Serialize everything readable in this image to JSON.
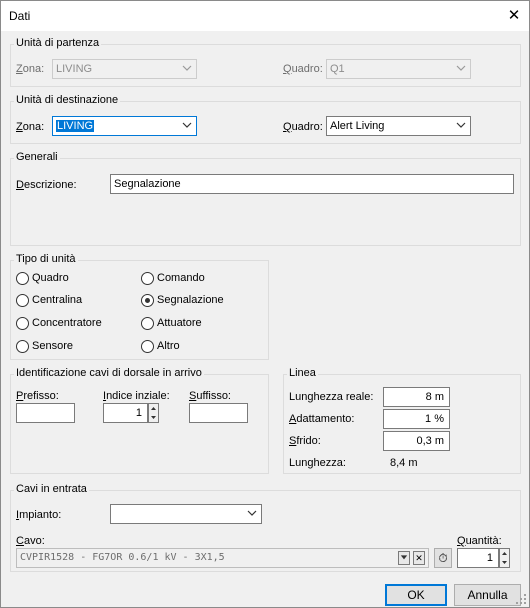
{
  "window": {
    "title": "Dati",
    "close_glyph": "✕"
  },
  "partenza": {
    "group_label": "Unità di partenza",
    "zona_label": "Zona:",
    "zona_value": "LIVING",
    "quadro_label": "Quadro:",
    "quadro_value": "Q1"
  },
  "destinazione": {
    "group_label": "Unità di destinazione",
    "zona_label": "Zona:",
    "zona_value": "LIVING",
    "quadro_label": "Quadro:",
    "quadro_value": "Alert Living"
  },
  "generali": {
    "group_label": "Generali",
    "descrizione_label": "Descrizione:",
    "descrizione_value": "Segnalazione"
  },
  "tipo_unita": {
    "group_label": "Tipo di unità",
    "options": [
      {
        "label": "Quadro",
        "selected": false
      },
      {
        "label": "Comando",
        "selected": false
      },
      {
        "label": "Centralina",
        "selected": false
      },
      {
        "label": "Segnalazione",
        "selected": true
      },
      {
        "label": "Concentratore",
        "selected": false
      },
      {
        "label": "Attuatore",
        "selected": false
      },
      {
        "label": "Sensore",
        "selected": false
      },
      {
        "label": "Altro",
        "selected": false
      }
    ]
  },
  "identificazione": {
    "group_label": "Identificazione cavi di dorsale in arrivo",
    "prefisso_label": "Prefisso:",
    "prefisso_value": "",
    "indice_label": "Indice inziale:",
    "indice_value": "1",
    "suffisso_label": "Suffisso:",
    "suffisso_value": ""
  },
  "linea": {
    "group_label": "Linea",
    "lunghezza_reale_label": "Lunghezza reale:",
    "lunghezza_reale_value": "8 m",
    "adattamento_label": "Adattamento:",
    "adattamento_value": "1 %",
    "sfrido_label": "Sfrido:",
    "sfrido_value": "0,3 m",
    "lunghezza_label": "Lunghezza:",
    "lunghezza_value": "8,4 m"
  },
  "cavi": {
    "group_label": "Cavi in entrata",
    "impianto_label": "Impianto:",
    "impianto_value": "",
    "cavo_label": "Cavo:",
    "cavo_value": "CVPIR1528 - FG7OR 0.6/1 kV - 3X1,5",
    "quantita_label": "Quantità:",
    "quantita_value": "1",
    "clear_glyph": "✕",
    "timer_glyph": "⏱"
  },
  "buttons": {
    "ok": "OK",
    "annulla": "Annulla"
  },
  "colors": {
    "accent": "#0078d7",
    "dialog_bg": "#f0f0f0"
  }
}
